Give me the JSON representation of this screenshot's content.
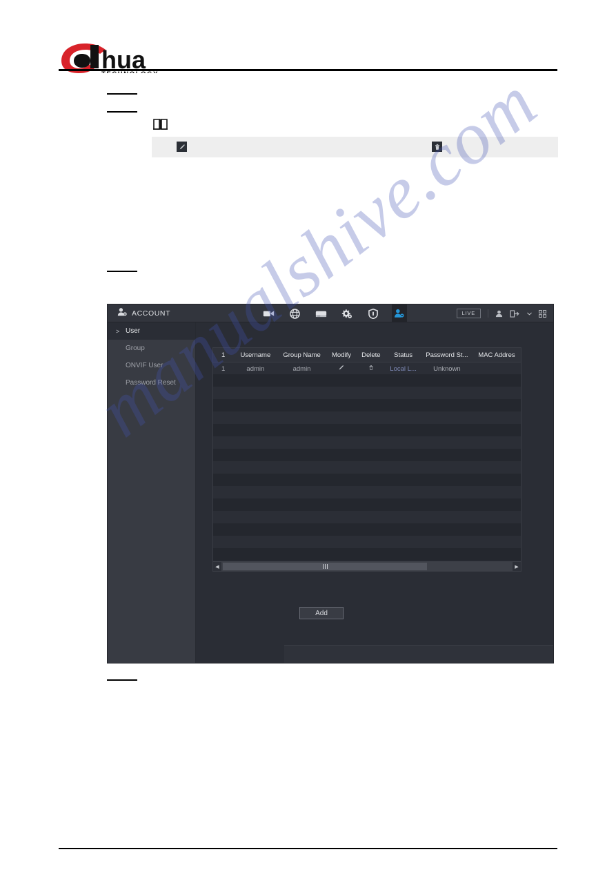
{
  "document": {
    "brand": "alhua",
    "brand_sub": "TECHNOLOGY",
    "watermark": "manualshive.com",
    "note_bar": {
      "edit_icon": "pencil-icon",
      "delete_icon": "trash-icon"
    },
    "note_icon": "book-icon"
  },
  "ui": {
    "header": {
      "title": "ACCOUNT",
      "title_icon": "user-gear-icon",
      "toolbar": [
        {
          "name": "camera-icon",
          "label": "Camera",
          "active": false
        },
        {
          "name": "network-icon",
          "label": "Network",
          "active": false
        },
        {
          "name": "storage-icon",
          "label": "Storage",
          "active": false
        },
        {
          "name": "system-icon",
          "label": "System",
          "active": false
        },
        {
          "name": "security-icon",
          "label": "Security",
          "active": false
        },
        {
          "name": "account-icon",
          "label": "Account",
          "active": true
        }
      ],
      "live_label": "LIVE",
      "right_icons": [
        {
          "name": "user-icon"
        },
        {
          "name": "logout-icon"
        },
        {
          "name": "chevron-down-icon"
        },
        {
          "name": "qr-grid-icon"
        }
      ]
    },
    "sidebar": {
      "items": [
        {
          "label": "User",
          "active": true,
          "chevron": ">"
        },
        {
          "label": "Group",
          "active": false,
          "chevron": ""
        },
        {
          "label": "ONVIF User",
          "active": false,
          "chevron": ""
        },
        {
          "label": "Password Reset",
          "active": false,
          "chevron": ""
        }
      ]
    },
    "table": {
      "columns": [
        "1",
        "Username",
        "Group Name",
        "Modify",
        "Delete",
        "Status",
        "Password St...",
        "MAC Addres"
      ],
      "rows": [
        {
          "index": "1",
          "username": "admin",
          "group_name": "admin",
          "modify_icon": "pencil-icon",
          "delete_icon": "trash-icon",
          "status": "Local L...",
          "password_strength": "Unknown",
          "mac_address": ""
        }
      ],
      "scrollbar": {
        "left_arrow": "◀",
        "right_arrow": "▶"
      }
    },
    "buttons": {
      "add": "Add"
    },
    "colors": {
      "panel_bg": "#2a2d35",
      "sidebar_bg": "#383b43",
      "header_bg": "#32353d",
      "accent": "#2596d8",
      "table_bg": "#22242b",
      "text": "#d8dadd",
      "muted_text": "#9ea1a8"
    }
  }
}
